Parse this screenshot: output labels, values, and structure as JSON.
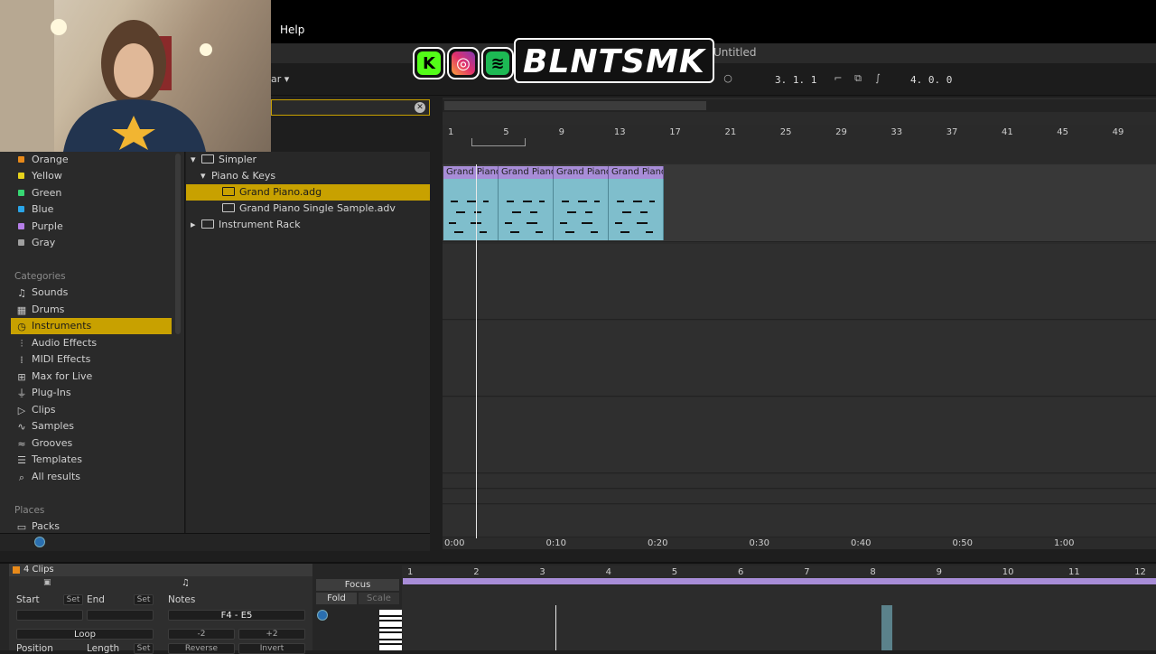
{
  "menubar": {
    "help": "Help"
  },
  "window": {
    "title": "Untitled"
  },
  "overlay": {
    "brand": "BLNTSMK"
  },
  "transport": {
    "bar_label": "ar",
    "position": "3.  1.  1",
    "loop_length": "4.  0.  0"
  },
  "browser": {
    "colors": [
      {
        "label": "Orange",
        "color": "#e88a1a"
      },
      {
        "label": "Yellow",
        "color": "#e6d21c"
      },
      {
        "label": "Green",
        "color": "#37d673"
      },
      {
        "label": "Blue",
        "color": "#2aa5e8"
      },
      {
        "label": "Purple",
        "color": "#b57ee8"
      },
      {
        "label": "Gray",
        "color": "#a0a0a0"
      }
    ],
    "categories_heading": "Categories",
    "categories": [
      {
        "label": "Sounds",
        "icon": "note-icon"
      },
      {
        "label": "Drums",
        "icon": "grid-icon"
      },
      {
        "label": "Instruments",
        "icon": "clock-icon",
        "selected": true
      },
      {
        "label": "Audio Effects",
        "icon": "wave-icon"
      },
      {
        "label": "MIDI Effects",
        "icon": "midi-icon"
      },
      {
        "label": "Max for Live",
        "icon": "max-icon"
      },
      {
        "label": "Plug-Ins",
        "icon": "plug-icon"
      },
      {
        "label": "Clips",
        "icon": "play-icon"
      },
      {
        "label": "Samples",
        "icon": "wave-icon"
      },
      {
        "label": "Grooves",
        "icon": "groove-icon"
      },
      {
        "label": "Templates",
        "icon": "template-icon"
      },
      {
        "label": "All results",
        "icon": "search-icon"
      }
    ],
    "places_heading": "Places",
    "places_first": "Packs",
    "files": [
      {
        "label": "Simpler",
        "indent": 0,
        "folder": true
      },
      {
        "label": "Piano & Keys",
        "indent": 1,
        "folder": false,
        "expanded": true
      },
      {
        "label": "Grand Piano.adg",
        "indent": 2,
        "selected": true
      },
      {
        "label": "Grand Piano Single Sample.adv",
        "indent": 2
      },
      {
        "label": "Instrument Rack",
        "indent": 0,
        "folder": true,
        "collapsed": true
      }
    ]
  },
  "arrangement": {
    "bar_numbers": [
      "1",
      "5",
      "9",
      "13",
      "17",
      "21",
      "25",
      "29",
      "33",
      "37",
      "41",
      "45",
      "49"
    ],
    "clips": [
      "Grand Piano",
      "Grand Piano",
      "Grand Piano",
      "Grand Piano"
    ],
    "time_labels": [
      "0:00",
      "0:10",
      "0:20",
      "0:30",
      "0:40",
      "0:50",
      "1:00"
    ]
  },
  "clip_view": {
    "title": "4 Clips",
    "start": "Start",
    "end": "End",
    "set": "Set",
    "notes": "Notes",
    "note_range": "F4 - E5",
    "loop": "Loop",
    "position": "Position",
    "length": "Length",
    "minus2": "-2",
    "plus2": "+2",
    "reverse": "Reverse",
    "invert": "Invert",
    "focus": "Focus",
    "fold": "Fold",
    "scale": "Scale",
    "bars": [
      "1",
      "2",
      "3",
      "4",
      "5",
      "6",
      "7",
      "8",
      "9",
      "10",
      "11",
      "12"
    ]
  }
}
